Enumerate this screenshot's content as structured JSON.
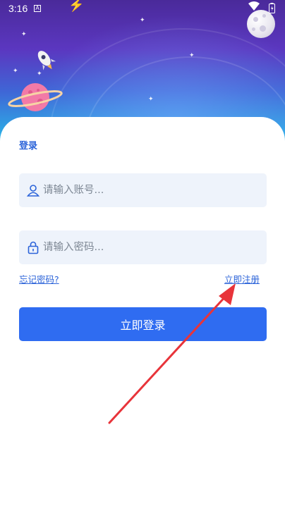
{
  "status_bar": {
    "time": "3:16",
    "notification_icon_letter": "A",
    "icons": [
      "a-icon",
      "bolt-icon",
      "wifi-icon",
      "battery-icon"
    ]
  },
  "login": {
    "title": "登录",
    "account_placeholder": "请输入账号...",
    "account_value": "",
    "password_placeholder": "请输入密码...",
    "password_value": "",
    "forgot_password_link": "忘记密码?",
    "register_link": "立即注册",
    "login_button": "立即登录"
  },
  "colors": {
    "accent": "#2f6cf1",
    "link": "#2b63d9",
    "input_bg": "#eef3fb",
    "hero_top": "#4a2a9a",
    "hero_bottom": "#2ab6e8",
    "annotation_arrow": "#e8343a"
  }
}
